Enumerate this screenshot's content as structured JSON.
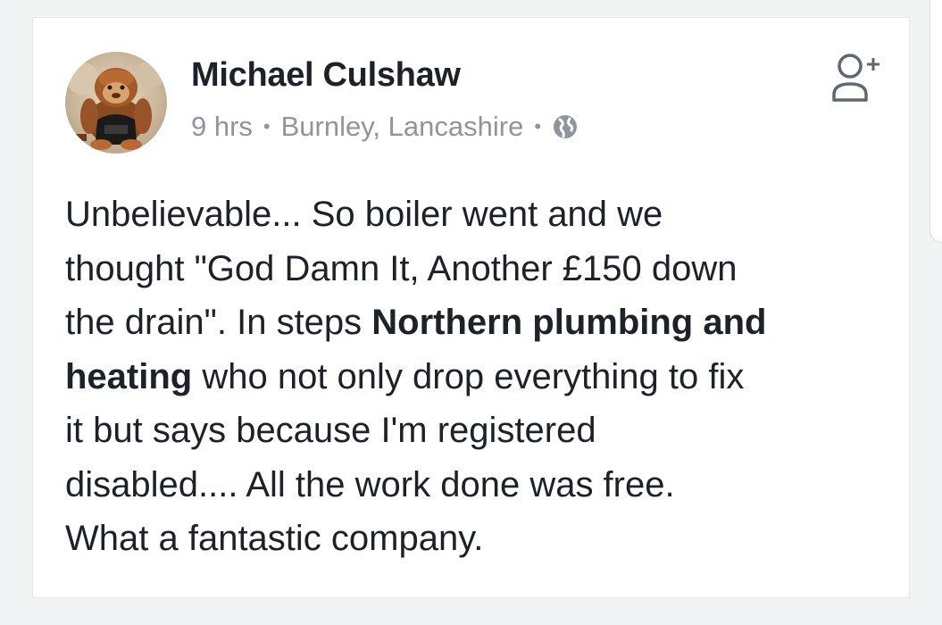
{
  "post": {
    "author_name": "Michael Culshaw",
    "timestamp": "9 hrs",
    "location": "Burnley, Lancashire",
    "separator": "•",
    "privacy_icon": "globe-icon",
    "add_friend_icon": "add-friend-icon",
    "avatar_icon": "orangutan-plush-avatar",
    "text": {
      "part1": "Unbelievable... So boiler went and we\nthought \"God Damn It, Another £150 down\nthe drain\". In steps ",
      "bold": "Northern plumbing and\nheating",
      "part2": " who not only drop everything to fix\nit but says because I'm registered\ndisabled.... All the work done was free.\nWhat a fantastic company."
    }
  },
  "colors": {
    "name": "#1d2129",
    "meta": "#90949c",
    "body_text": "#1d2129",
    "card_border": "#e4e6ea",
    "background": "#f2f3f5"
  }
}
